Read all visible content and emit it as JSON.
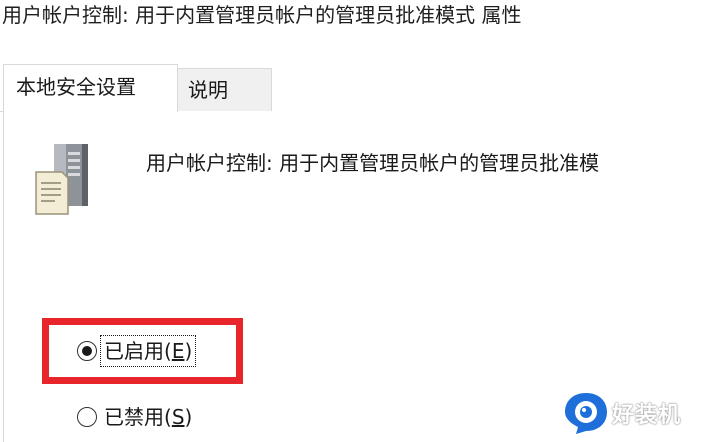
{
  "window": {
    "title": "用户帐户控制: 用于内置管理员帐户的管理员批准模式 属性"
  },
  "tabs": [
    {
      "label": "本地安全设置",
      "active": true
    },
    {
      "label": "说明",
      "active": false
    }
  ],
  "policy": {
    "icon": "server-document-icon",
    "description": "用户帐户控制: 用于内置管理员帐户的管理员批准模"
  },
  "options": {
    "enabled": {
      "label_prefix": "已启用(",
      "mnemonic": "E",
      "label_suffix": ")",
      "selected": true
    },
    "disabled": {
      "label_prefix": "已禁用(",
      "mnemonic": "S",
      "label_suffix": ")",
      "selected": false
    }
  },
  "highlight": {
    "color": "#e8252b"
  },
  "watermark": {
    "text": "好装机",
    "logo": "watermark-logo-icon",
    "accent": "#1e6fd9"
  }
}
